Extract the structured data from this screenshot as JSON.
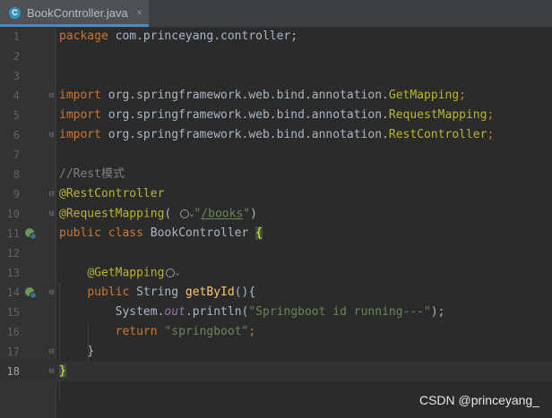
{
  "tab": {
    "label": "BookController.java",
    "icon": "class-c-icon",
    "close": "×"
  },
  "lines": [
    {
      "num": "1"
    },
    {
      "num": "2"
    },
    {
      "num": "3"
    },
    {
      "num": "4"
    },
    {
      "num": "5"
    },
    {
      "num": "6"
    },
    {
      "num": "7"
    },
    {
      "num": "8"
    },
    {
      "num": "9"
    },
    {
      "num": "10"
    },
    {
      "num": "11"
    },
    {
      "num": "12"
    },
    {
      "num": "13"
    },
    {
      "num": "14"
    },
    {
      "num": "15"
    },
    {
      "num": "16"
    },
    {
      "num": "17"
    },
    {
      "num": "18"
    }
  ],
  "code": {
    "l1_kw": "package",
    "l1_rest": " com.princeyang.controller;",
    "import_kw": "import",
    "l4_pkg": " org.springframework.web.bind.annotation.",
    "l4_cls": "GetMapping",
    "l5_cls": "RequestMapping",
    "l6_cls": "RestController",
    "semi": ";",
    "l8_comment": "//Rest模式",
    "l9_ann": "@RestController",
    "l10_ann": "@RequestMapping",
    "l10_open": "( ",
    "l10_str_q1": "\"",
    "l10_url": "/books",
    "l10_str_q2": "\"",
    "l10_close": ")",
    "l11_kw1": "public",
    "l11_kw2": "class",
    "l11_name": " BookController ",
    "l11_brace": "{",
    "l13_ann": "@GetMapping",
    "l14_kw": "public",
    "l14_type": " String ",
    "l14_fn": "getById",
    "l14_rest": "(){",
    "l15_a": "System.",
    "l15_out": "out",
    "l15_b": ".println(",
    "l15_str": "\"Springboot id running---\"",
    "l15_c": ");",
    "l16_kw": "return",
    "l16_str": "\"springboot\"",
    "l16_semi": ";",
    "l17": "}",
    "l18": "}"
  },
  "watermark": "CSDN @princeyang_",
  "colors": {
    "background": "#2b2b2b",
    "keyword": "#cc7832",
    "annotation": "#bbb529",
    "string": "#6a8759",
    "method": "#ffc66d"
  }
}
